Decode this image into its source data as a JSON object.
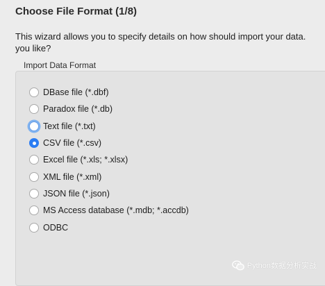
{
  "wizard": {
    "title": "Choose File Format (1/8)",
    "description_line1": "This wizard allows you to specify details on how should import your data.",
    "description_line2": "you like?"
  },
  "import_format": {
    "group_label": "Import Data Format",
    "options": [
      {
        "label": "DBase file (*.dbf)",
        "selected": false,
        "focused": false
      },
      {
        "label": "Paradox file (*.db)",
        "selected": false,
        "focused": false
      },
      {
        "label": "Text file (*.txt)",
        "selected": false,
        "focused": true
      },
      {
        "label": "CSV file (*.csv)",
        "selected": true,
        "focused": false
      },
      {
        "label": "Excel file (*.xls; *.xlsx)",
        "selected": false,
        "focused": false
      },
      {
        "label": "XML file (*.xml)",
        "selected": false,
        "focused": false
      },
      {
        "label": "JSON file (*.json)",
        "selected": false,
        "focused": false
      },
      {
        "label": "MS Access database (*.mdb; *.accdb)",
        "selected": false,
        "focused": false
      },
      {
        "label": "ODBC",
        "selected": false,
        "focused": false
      }
    ]
  },
  "watermark": {
    "text": "Python数据分析实战",
    "icon": "wechat-icon"
  },
  "colors": {
    "accent": "#2a7cf3",
    "focus_ring": "#7fb2f0",
    "background": "#ececec",
    "group_background": "#e3e3e3"
  }
}
